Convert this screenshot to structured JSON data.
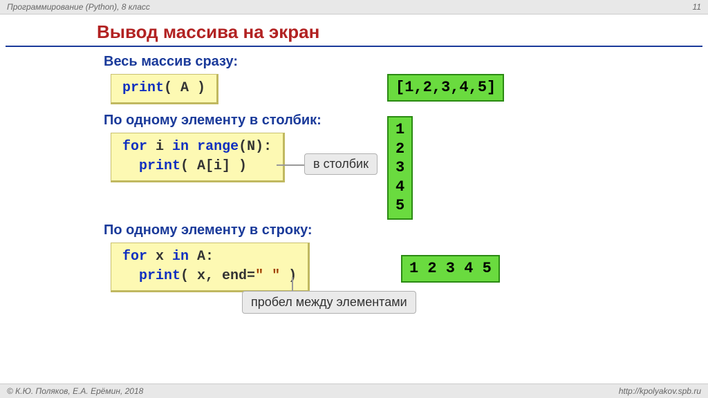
{
  "top": {
    "left": "Программирование (Python), 8 класс",
    "page": "11"
  },
  "title": "Вывод массива на экран",
  "s1": {
    "head": "Весь массив сразу:",
    "code_html": "<span class=\"kw\">print</span>( A )",
    "out": "[1,2,3,4,5]"
  },
  "s2": {
    "head": "По одному элементу в столбик:",
    "code_html": "<span class=\"kw\">for</span> i <span class=\"kw\">in</span> <span class=\"kw\">range</span>(N):\n  <span class=\"kw\">print</span>( A[i] )",
    "callout": "в столбик",
    "out": "1\n2\n3\n4\n5"
  },
  "s3": {
    "head": "По одному элементу в строку:",
    "code_html": "<span class=\"kw\">for</span> x <span class=\"kw\">in</span> A:\n  <span class=\"kw\">print</span>( x, end=<span class=\"str\">\" \"</span> )",
    "callout": "пробел между\nэлементами",
    "out": "1 2 3 4 5"
  },
  "foot": {
    "left": "© К.Ю. Поляков, Е.А. Ерёмин, 2018",
    "right": "http://kpolyakov.spb.ru"
  }
}
